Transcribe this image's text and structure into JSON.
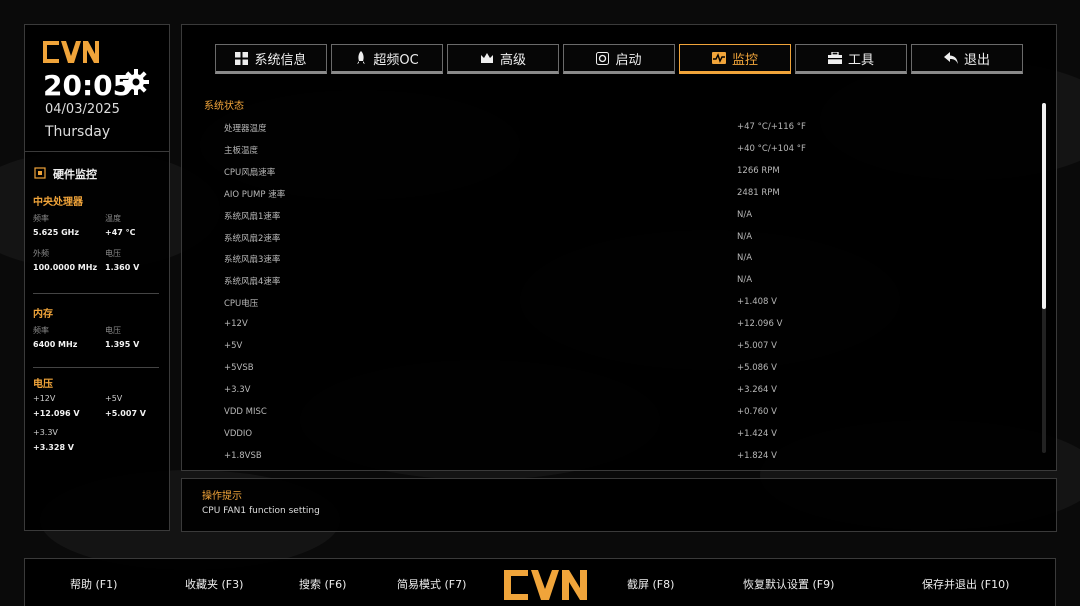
{
  "brand": {
    "logo_text": "CVN",
    "accent": "#f0a43a"
  },
  "clock": {
    "time": "20:05",
    "date": "04/03/2025",
    "weekday": "Thursday"
  },
  "hardware_monitor": {
    "title": "硬件监控",
    "cpu": {
      "title": "中央处理器",
      "freq_label": "频率",
      "freq_value": "5.625 GHz",
      "temp_label": "温度",
      "temp_value": "+47 °C",
      "bclk_label": "外频",
      "bclk_value": "100.0000 MHz",
      "volt_label": "电压",
      "volt_value": "1.360 V"
    },
    "memory": {
      "title": "内存",
      "freq_label": "频率",
      "freq_value": "6400 MHz",
      "volt_label": "电压",
      "volt_value": "1.395 V"
    },
    "voltage": {
      "title": "电压",
      "v12_label": "+12V",
      "v12_value": "+12.096 V",
      "v5_label": "+5V",
      "v5_value": "+5.007 V",
      "v33_label": "+3.3V",
      "v33_value": "+3.328 V"
    }
  },
  "tabs": [
    {
      "label": "系统信息",
      "icon": "grid-icon",
      "active": false
    },
    {
      "label": "超频OC",
      "icon": "rocket-icon",
      "active": false
    },
    {
      "label": "高级",
      "icon": "crown-icon",
      "active": false
    },
    {
      "label": "启动",
      "icon": "power-icon",
      "active": false
    },
    {
      "label": "监控",
      "icon": "monitor-icon",
      "active": true
    },
    {
      "label": "工具",
      "icon": "toolbox-icon",
      "active": false
    },
    {
      "label": "退出",
      "icon": "exit-arrow-icon",
      "active": false
    }
  ],
  "system_status": {
    "title": "系统状态",
    "rows": [
      {
        "label": "处理器温度",
        "value": "+47 °C/+116 °F"
      },
      {
        "label": "主板温度",
        "value": "+40 °C/+104 °F"
      },
      {
        "label": "CPU风扇速率",
        "value": "1266 RPM"
      },
      {
        "label": "AIO PUMP 速率",
        "value": "2481 RPM"
      },
      {
        "label": "系统风扇1速率",
        "value": "N/A"
      },
      {
        "label": "系统风扇2速率",
        "value": "N/A"
      },
      {
        "label": "系统风扇3速率",
        "value": "N/A"
      },
      {
        "label": "系统风扇4速率",
        "value": "N/A"
      },
      {
        "label": "CPU电压",
        "value": "+1.408 V"
      },
      {
        "label": "+12V",
        "value": "+12.096 V"
      },
      {
        "label": "+5V",
        "value": "+5.007 V"
      },
      {
        "label": "+5VSB",
        "value": "+5.086 V"
      },
      {
        "label": "+3.3V",
        "value": "+3.264 V"
      },
      {
        "label": "VDD MISC",
        "value": "+0.760 V"
      },
      {
        "label": "VDDIO",
        "value": "+1.424 V"
      },
      {
        "label": "+1.8VSB",
        "value": "+1.824 V"
      }
    ]
  },
  "hint": {
    "title": "操作提示",
    "text": "CPU FAN1 function setting"
  },
  "footer": {
    "help": "帮助 (F1)",
    "favorites": "收藏夹 (F3)",
    "search": "搜索 (F6)",
    "easy_mode": "简易模式 (F7)",
    "screenshot": "截屏 (F8)",
    "load_defaults": "恢复默认设置 (F9)",
    "save_exit": "保存并退出 (F10)"
  }
}
